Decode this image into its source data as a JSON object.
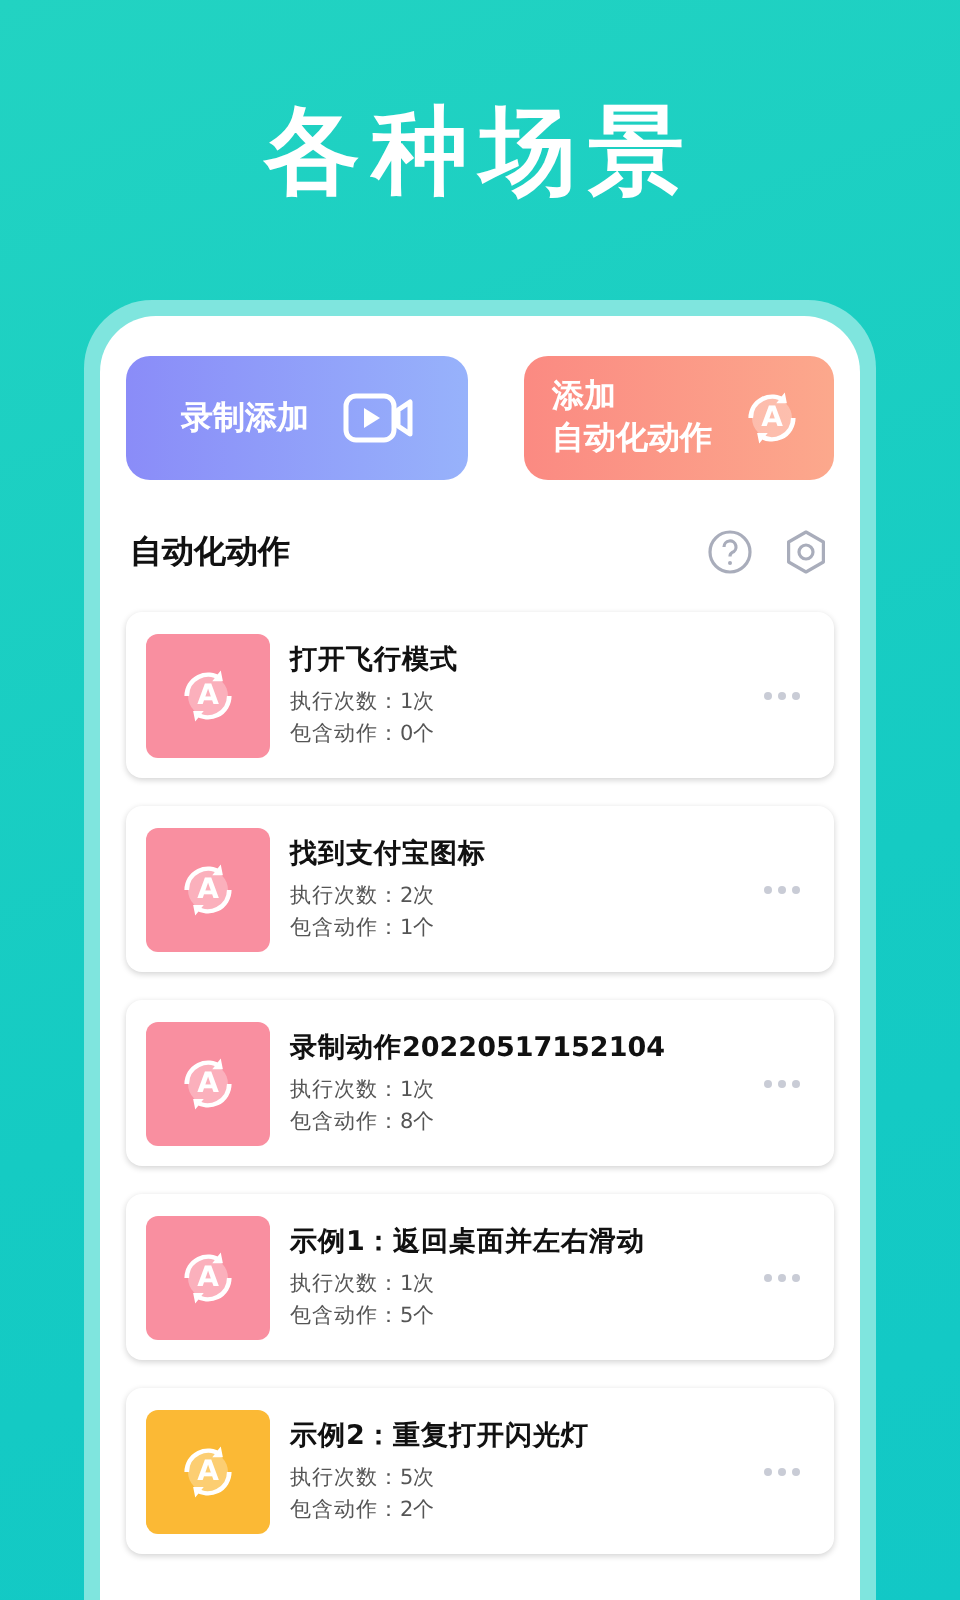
{
  "headline": "各种场景",
  "actions": [
    {
      "kind": "record",
      "label": "录制添加"
    },
    {
      "kind": "auto",
      "label_lines": [
        "添加",
        "自动化动作"
      ],
      "badge_letter": "A"
    }
  ],
  "section": {
    "title": "自动化动作"
  },
  "items": [
    {
      "title": "打开飞行模式",
      "runs": "执行次数：1次",
      "contains": "包含动作：0个",
      "color": "#f98fa0",
      "badge_letter": "A"
    },
    {
      "title": "找到支付宝图标",
      "runs": "执行次数：2次",
      "contains": "包含动作：1个",
      "color": "#f98fa0",
      "badge_letter": "A"
    },
    {
      "title": "录制动作20220517152104",
      "runs": "执行次数：1次",
      "contains": "包含动作：8个",
      "color": "#f98fa0",
      "badge_letter": "A"
    },
    {
      "title": "示例1：返回桌面并左右滑动",
      "runs": "执行次数：1次",
      "contains": "包含动作：5个",
      "color": "#f98fa0",
      "badge_letter": "A"
    },
    {
      "title": "示例2：重复打开闪光灯",
      "runs": "执行次数：5次",
      "contains": "包含动作：2个",
      "color": "#fbb935",
      "badge_letter": "A"
    }
  ]
}
